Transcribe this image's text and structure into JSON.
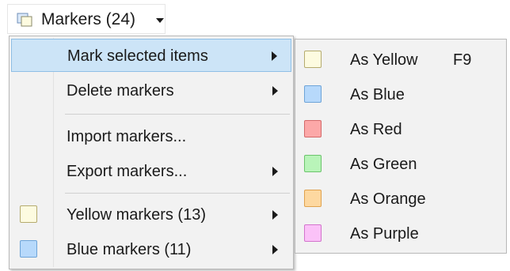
{
  "toolbar": {
    "markers_label": "Markers (24)",
    "icon": "markers-icon"
  },
  "menu": {
    "items": [
      {
        "label": "Mark selected items",
        "submenu": true,
        "highlighted": true
      },
      {
        "label": "Delete markers",
        "submenu": true
      },
      {
        "label": "Import markers...",
        "submenu": false
      },
      {
        "label": "Export markers...",
        "submenu": true
      },
      {
        "label": "Yellow markers (13)",
        "submenu": true,
        "swatch": {
          "fill": "#fdfbe0",
          "border": "#b5ab6e"
        }
      },
      {
        "label": "Blue markers (11)",
        "submenu": true,
        "swatch": {
          "fill": "#b7d9fb",
          "border": "#6ea4d8"
        }
      }
    ]
  },
  "submenu": {
    "items": [
      {
        "label": "As Yellow",
        "shortcut": "F9",
        "fill": "#fdfbe0",
        "border": "#b5ab6e"
      },
      {
        "label": "As Blue",
        "fill": "#b7d9fb",
        "border": "#6ea4d8"
      },
      {
        "label": "As Red",
        "fill": "#fca8a8",
        "border": "#d46a6a"
      },
      {
        "label": "As Green",
        "fill": "#b9f4b9",
        "border": "#6cc46c"
      },
      {
        "label": "As Orange",
        "fill": "#fdd8a0",
        "border": "#e0a24e"
      },
      {
        "label": "As Purple",
        "fill": "#fbc2f8",
        "border": "#d274cc"
      }
    ]
  },
  "colors": {
    "menu_bg": "#f2f2f2",
    "highlight_bg": "#cce4f7",
    "highlight_border": "#8fbfe6"
  }
}
